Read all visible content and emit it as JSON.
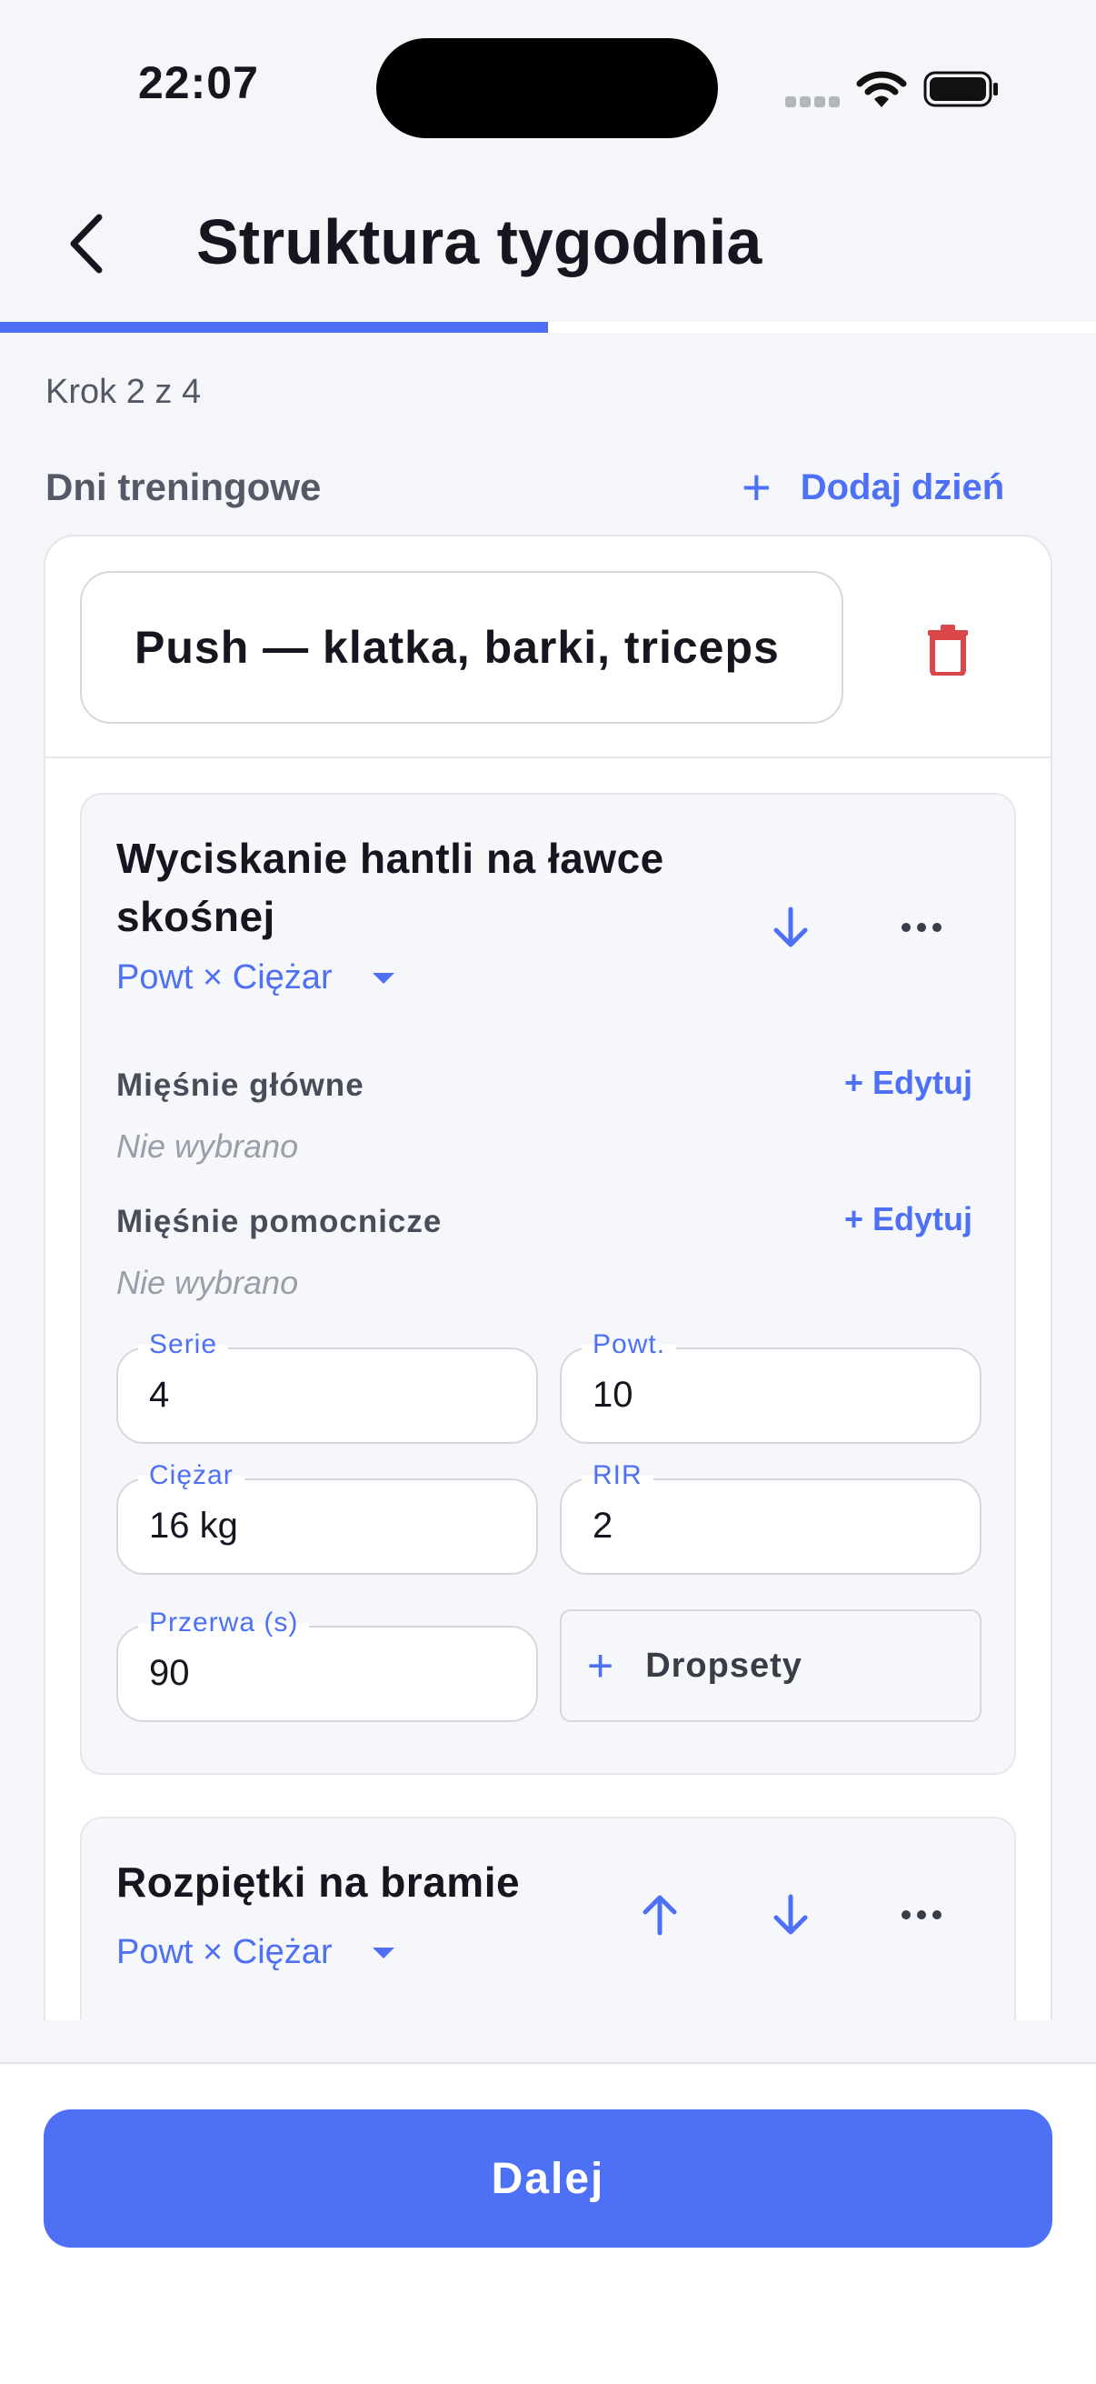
{
  "status_bar": {
    "time": "22:07"
  },
  "header": {
    "title": "Struktura tygodnia",
    "progress": 0.5
  },
  "step": {
    "label": "Krok 2 z 4"
  },
  "section": {
    "label": "Dni treningowe",
    "add_day_label": "Dodaj dzień"
  },
  "day": {
    "name": "Push — klatka, barki, triceps",
    "exercises": [
      {
        "name": "Wyciskanie hantli na ławce skośnej",
        "type": "Powt × Ciężar",
        "primary_label": "Mięśnie główne",
        "primary_value": "Nie wybrano",
        "secondary_label": "Mięśnie pomocnicze",
        "secondary_value": "Nie wybrano",
        "edit_label": "+ Edytuj",
        "sets_label": "Serie",
        "sets": "4",
        "reps_label": "Powt.",
        "reps": "10",
        "weight_label": "Ciężar",
        "weight": "16 kg",
        "rir_label": "RIR",
        "rir": "2",
        "rest_label": "Przerwa (s)",
        "rest": "90",
        "dropsets_label": "Dropsety"
      },
      {
        "name": "Rozpiętki na bramie",
        "type": "Powt × Ciężar"
      }
    ]
  },
  "footer": {
    "next_label": "Dalej"
  },
  "colors": {
    "accent": "#4d70f5",
    "danger": "#d9474a"
  }
}
